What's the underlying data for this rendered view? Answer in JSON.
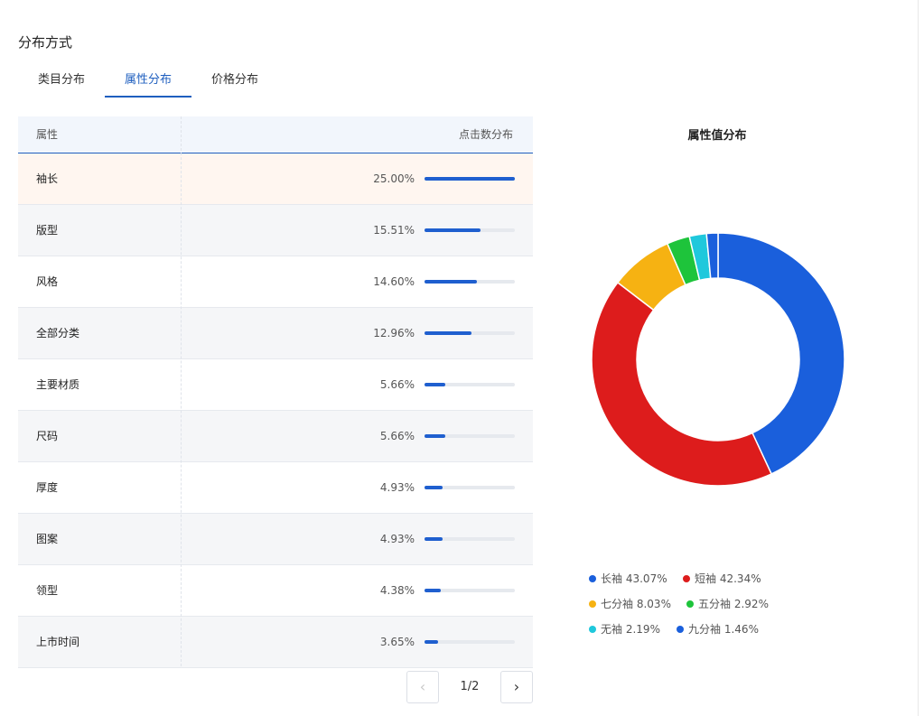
{
  "section_title": "分布方式",
  "tabs": [
    {
      "label": "类目分布",
      "active": false
    },
    {
      "label": "属性分布",
      "active": true
    },
    {
      "label": "价格分布",
      "active": false
    }
  ],
  "table": {
    "headers": {
      "attribute": "属性",
      "distribution": "点击数分布"
    },
    "rows": [
      {
        "name": "袖长",
        "pct_label": "25.00%",
        "value": 25.0
      },
      {
        "name": "版型",
        "pct_label": "15.51%",
        "value": 15.51
      },
      {
        "name": "风格",
        "pct_label": "14.60%",
        "value": 14.6
      },
      {
        "name": "全部分类",
        "pct_label": "12.96%",
        "value": 12.96
      },
      {
        "name": "主要材质",
        "pct_label": "5.66%",
        "value": 5.66
      },
      {
        "name": "尺码",
        "pct_label": "5.66%",
        "value": 5.66
      },
      {
        "name": "厚度",
        "pct_label": "4.93%",
        "value": 4.93
      },
      {
        "name": "图案",
        "pct_label": "4.93%",
        "value": 4.93
      },
      {
        "name": "领型",
        "pct_label": "4.38%",
        "value": 4.38
      },
      {
        "name": "上市时间",
        "pct_label": "3.65%",
        "value": 3.65
      }
    ],
    "max_value": 25.0,
    "highlight_color": "#fff6f0",
    "bar_color": "#1f5fcf"
  },
  "pagination": {
    "page_text": "1/2",
    "prev_icon": "chevron-left-icon",
    "next_icon": "chevron-right-icon",
    "prev_disabled": true
  },
  "chart_data": {
    "type": "pie",
    "title": "属性值分布",
    "categories": [
      "长袖",
      "短袖",
      "七分袖",
      "五分袖",
      "无袖",
      "九分袖"
    ],
    "values": [
      43.07,
      42.34,
      8.03,
      2.92,
      2.19,
      1.46
    ],
    "labels": [
      "43.07%",
      "42.34%",
      "8.03%",
      "2.92%",
      "2.19%",
      "1.46%"
    ],
    "colors": [
      "#1a5fdc",
      "#dd1c1c",
      "#f6b212",
      "#1ec43b",
      "#1fc8dc",
      "#1a5fdc"
    ],
    "legend": "bottom"
  }
}
